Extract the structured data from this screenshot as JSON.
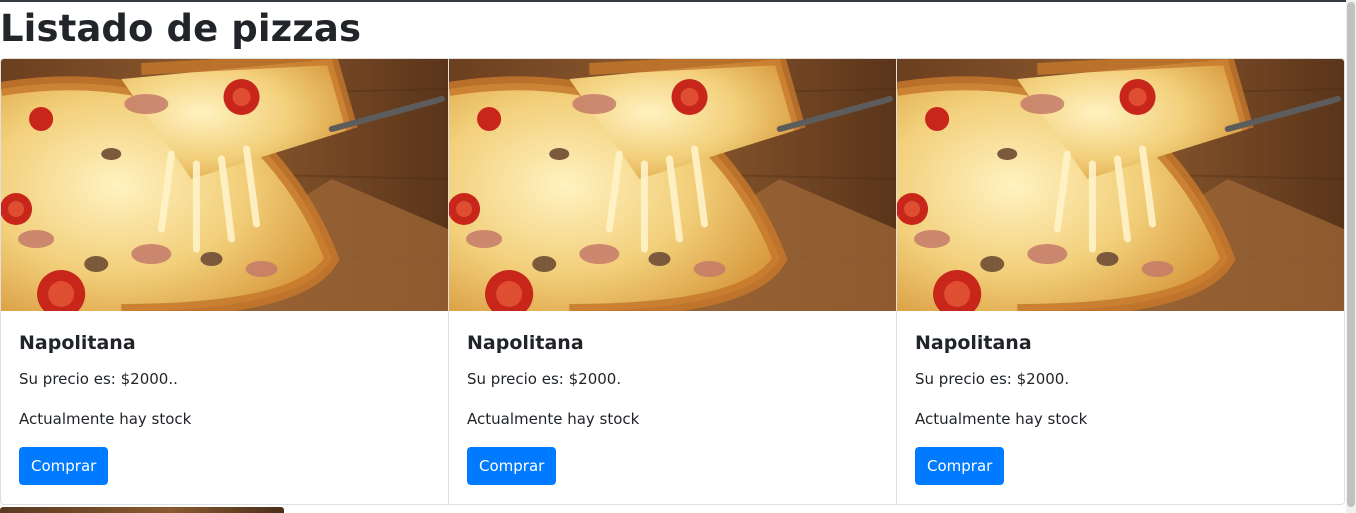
{
  "page": {
    "title": "Listado de pizzas"
  },
  "cards": [
    {
      "name": "Napolitana",
      "price_text": "Su precio es: $2000..",
      "stock_text": "Actualmente hay stock",
      "button_label": "Comprar"
    },
    {
      "name": "Napolitana",
      "price_text": "Su precio es: $2000.",
      "stock_text": "Actualmente hay stock",
      "button_label": "Comprar"
    },
    {
      "name": "Napolitana",
      "price_text": "Su precio es: $2000.",
      "stock_text": "Actualmente hay stock",
      "button_label": "Comprar"
    }
  ],
  "colors": {
    "primary_button": "#007bff",
    "text": "#212529",
    "border": "#dfdfdf"
  },
  "icons": {
    "card_image": "pizza-photo"
  }
}
